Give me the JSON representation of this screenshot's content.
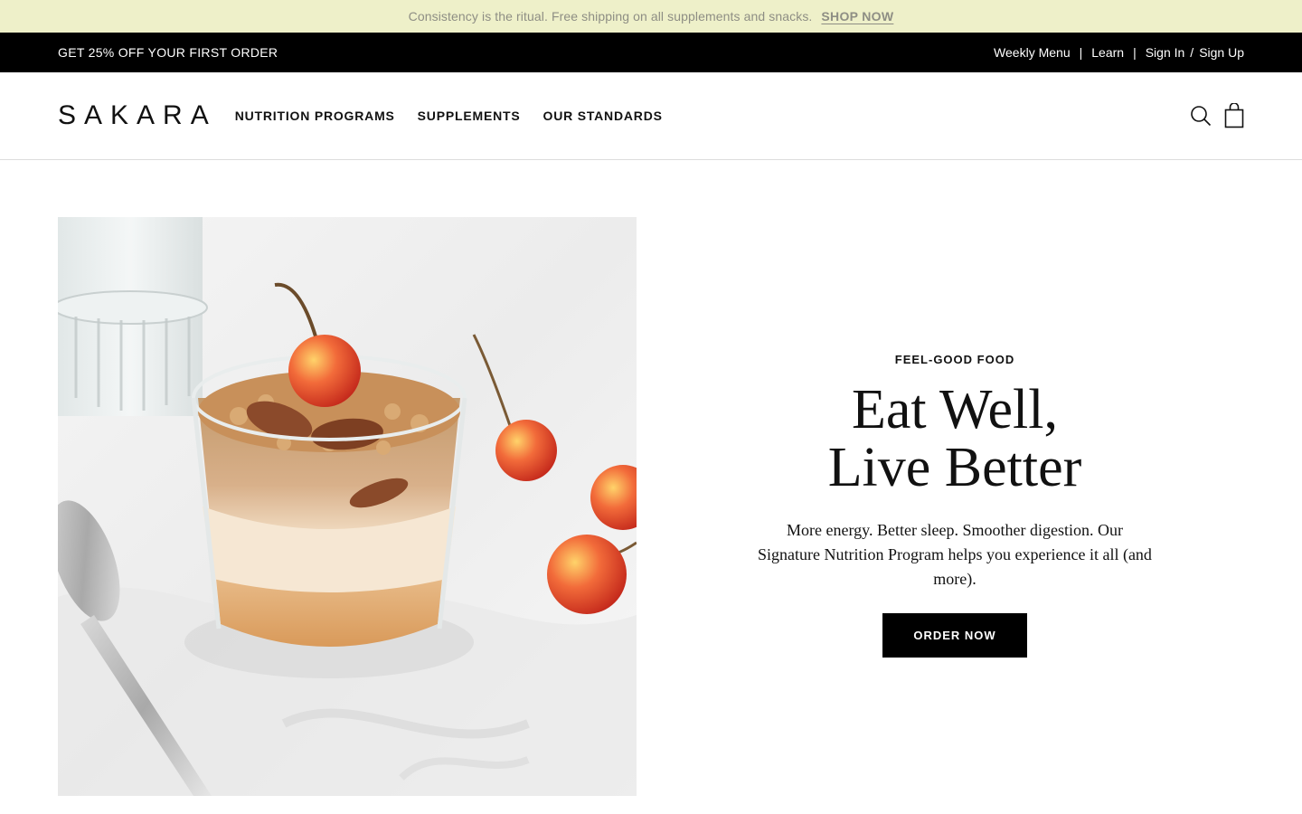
{
  "announcement": {
    "message": "Consistency is the ritual. Free shipping on all supplements and snacks.",
    "cta": "SHOP NOW"
  },
  "promo_bar": {
    "offer": "GET 25% OFF YOUR FIRST ORDER",
    "links": {
      "weekly_menu": "Weekly Menu",
      "separator": "|",
      "learn": "Learn",
      "sign_in": "Sign In",
      "slash": "/",
      "sign_up": "Sign Up"
    }
  },
  "header": {
    "logo": "SAKARA",
    "nav": {
      "nutrition_programs": "NUTRITION PROGRAMS",
      "supplements": "SUPPLEMENTS",
      "our_standards": "OUR STANDARDS"
    },
    "icons": [
      "search-icon",
      "shopping-bag-icon"
    ]
  },
  "hero": {
    "eyebrow": "FEEL-GOOD FOOD",
    "headline_line1": "Eat Well,",
    "headline_line2": "Live Better",
    "body": "More energy. Better sleep. Smoother digestion. Our Signature Nutrition Program helps you experience it all (and more).",
    "cta": "ORDER NOW"
  },
  "colors": {
    "announcement_bg": "#eef0c9",
    "announcement_text": "#8e8e84",
    "promo_bg": "#000000",
    "button_bg": "#000000"
  }
}
